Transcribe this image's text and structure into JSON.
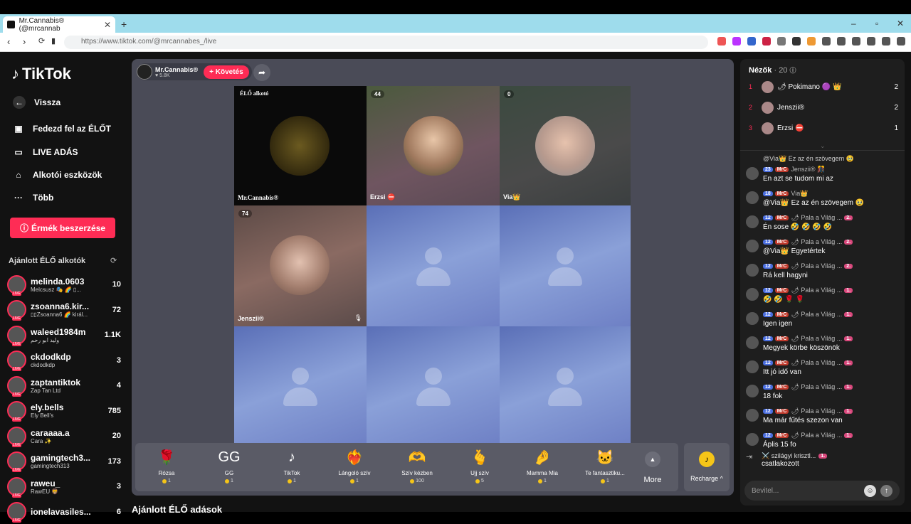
{
  "browser": {
    "tab_title": "Mr.Cannabis® (@mrcannab",
    "url": "https://www.tiktok.com/@mrcannabes_/live"
  },
  "sidebar": {
    "logo": "TikTok",
    "nav": [
      {
        "label": "Vissza",
        "icon": "arrow-left-icon"
      },
      {
        "label": "Fedezd fel az ÉLŐT",
        "icon": "explore-live-icon"
      },
      {
        "label": "LIVE ADÁS",
        "icon": "live-camera-icon"
      },
      {
        "label": "Alkotói eszközök",
        "icon": "creator-tools-icon"
      },
      {
        "label": "Több",
        "icon": "more-dots-icon"
      }
    ],
    "coin_button": "Érmék beszerzése",
    "recommended_title": "Ajánlott ÉLŐ alkotók",
    "live_badge": "LIVE",
    "creators": [
      {
        "name": "melinda.0603",
        "sub": "Melcsusz 🎭 🌈 ▯...",
        "count": "10"
      },
      {
        "name": "zsoanna6.kir...",
        "sub": "▯▯Zsoanna6 🌈 királ...",
        "count": "72"
      },
      {
        "name": "waleed1984m",
        "sub": "وليد ابو رحم",
        "count": "1.1K"
      },
      {
        "name": "ckdodkdp",
        "sub": "ckdodkdp",
        "count": "3"
      },
      {
        "name": "zaptantiktok",
        "sub": "Zap Tan Ltd",
        "count": "4"
      },
      {
        "name": "ely.bells",
        "sub": "Ely Bell's",
        "count": "785"
      },
      {
        "name": "caraaaa.a",
        "sub": "Cara ✨",
        "count": "20"
      },
      {
        "name": "gamingtech3...",
        "sub": "gamingtech313",
        "count": "173"
      },
      {
        "name": "raweu_",
        "sub": "RawEU 🦁",
        "count": "3"
      },
      {
        "name": "ionelavasiles...",
        "sub": "",
        "count": "6"
      }
    ]
  },
  "stream": {
    "host_name": "Mr.Cannabis®",
    "host_likes": "♥ 5.8K",
    "follow_label": "+ Követés",
    "cells": [
      {
        "label": "Mr.Cannabis®",
        "tag": "ÉLŐ alkotó",
        "count": ""
      },
      {
        "label": "Erzsi ⛔",
        "tag": "",
        "count": "44"
      },
      {
        "label": "Via👑",
        "tag": "",
        "count": "0"
      },
      {
        "label": "Jenszii®",
        "tag": "",
        "count": "74"
      }
    ]
  },
  "gifts": [
    {
      "name": "Rózsa",
      "price": "1",
      "icon": "🌹"
    },
    {
      "name": "GG",
      "price": "1",
      "icon": "GG"
    },
    {
      "name": "TikTok",
      "price": "1",
      "icon": "♪"
    },
    {
      "name": "Lángoló szív",
      "price": "1",
      "icon": "❤️‍🔥"
    },
    {
      "name": "Szív kézben",
      "price": "100",
      "icon": "🫶"
    },
    {
      "name": "Ujj szív",
      "price": "5",
      "icon": "🫰"
    },
    {
      "name": "Mamma Mia",
      "price": "1",
      "icon": "🤌"
    },
    {
      "name": "Te fantasztiku...",
      "price": "1",
      "icon": "🐱"
    }
  ],
  "more_label": "More",
  "recharge_label": "Recharge ^",
  "bottom_title": "Ajánlott ÉLŐ adások",
  "viewers": {
    "title": "Nézők",
    "count": "· 20",
    "list": [
      {
        "rank": "1",
        "name": "🌶 Pokimano 🟣 👑",
        "score": "2"
      },
      {
        "rank": "2",
        "name": "Jenszii®",
        "score": "2"
      },
      {
        "rank": "3",
        "name": "Erzsi ⛔",
        "score": "1"
      }
    ]
  },
  "chat": [
    {
      "lvl": "",
      "fan": "",
      "user": "",
      "text": "@Via👑 Ez az én szövegem 🥹",
      "rank": ""
    },
    {
      "lvl": "23",
      "fan": "MrC",
      "user": "Jenszii® 🎊",
      "text": "En azt se tudom mi az",
      "rank": ""
    },
    {
      "lvl": "18",
      "fan": "MrC",
      "user": "Via👑",
      "text": "@Via👑 Ez az én szövegem 🥹",
      "rank": ""
    },
    {
      "lvl": "12",
      "fan": "MrC",
      "user": "🌶 Pala a Világ ...",
      "text": "Én sose 🤣 🤣 🤣 🤣",
      "rank": "2."
    },
    {
      "lvl": "12",
      "fan": "MrC",
      "user": "🌶 Pala a Világ ...",
      "text": "@Via👑 Egyetértek",
      "rank": "2."
    },
    {
      "lvl": "12",
      "fan": "MrC",
      "user": "🌶 Pala a Világ ...",
      "text": "Rá kell hagyni",
      "rank": "2."
    },
    {
      "lvl": "12",
      "fan": "MrC",
      "user": "🌶 Pala a Világ ...",
      "text": "🤣 🤣 🌹 🌹",
      "rank": "1."
    },
    {
      "lvl": "12",
      "fan": "MrC",
      "user": "🌶 Pala a Világ ...",
      "text": "Igen igen",
      "rank": "1."
    },
    {
      "lvl": "12",
      "fan": "MrC",
      "user": "🌶 Pala a Világ ...",
      "text": "Megyek körbe köszönök",
      "rank": "1."
    },
    {
      "lvl": "12",
      "fan": "MrC",
      "user": "🌶 Pala a Világ ...",
      "text": "Itt jó idő van",
      "rank": "1."
    },
    {
      "lvl": "12",
      "fan": "MrC",
      "user": "🌶 Pala a Világ ...",
      "text": "18 fok",
      "rank": "1."
    },
    {
      "lvl": "12",
      "fan": "MrC",
      "user": "🌶 Pala a Világ ...",
      "text": "Ma már fűtés szezon van",
      "rank": "1."
    },
    {
      "lvl": "12",
      "fan": "MrC",
      "user": "🌶 Pala a Világ ...",
      "text": "Áplis 15 fo",
      "rank": "1."
    }
  ],
  "join": {
    "user": "⚔️ szilágyi krisztl...",
    "rank": "1.",
    "text": "csatlakozott"
  },
  "chat_input_placeholder": "Bevitel..."
}
